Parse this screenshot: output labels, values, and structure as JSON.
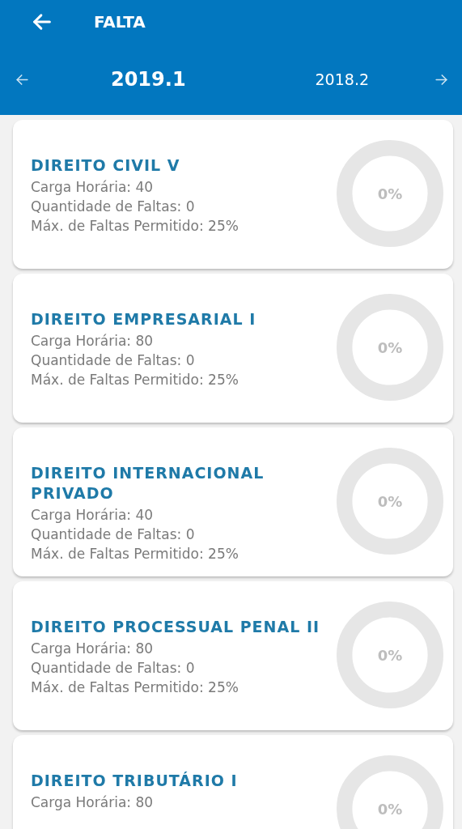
{
  "header": {
    "title": "FALTA"
  },
  "periods": [
    {
      "label": "2019.1",
      "selected": true
    },
    {
      "label": "2018.2",
      "selected": false
    }
  ],
  "courses": [
    {
      "name": "DIREITO CIVIL V",
      "details": [
        "Carga Horária: 40",
        "Quantidade de Faltas: 0",
        "Máx. de Faltas Permitido: 25%"
      ],
      "percent": "0%"
    },
    {
      "name": "DIREITO EMPRESARIAL I",
      "details": [
        "Carga Horária: 80",
        "Quantidade de Faltas: 0",
        "Máx. de Faltas Permitido: 25%"
      ],
      "percent": "0%"
    },
    {
      "name": "DIREITO INTERNACIONAL PRIVADO",
      "details": [
        "Carga Horária: 40",
        "Quantidade de Faltas: 0",
        "Máx. de Faltas Permitido: 25%"
      ],
      "percent": "0%"
    },
    {
      "name": "DIREITO PROCESSUAL PENAL II",
      "details": [
        "Carga Horária: 80",
        "Quantidade de Faltas: 0",
        "Máx. de Faltas Permitido: 25%"
      ],
      "percent": "0%"
    },
    {
      "name": "DIREITO TRIBUTÁRIO I",
      "details": [
        "Carga Horária: 80"
      ],
      "percent": "0%"
    }
  ]
}
